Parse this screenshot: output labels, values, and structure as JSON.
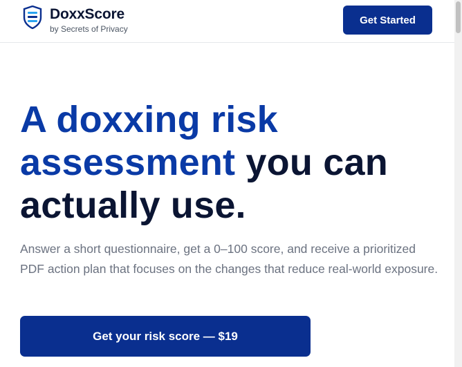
{
  "header": {
    "brand_name": "DoxxScore",
    "brand_sub": "by Secrets of Privacy",
    "cta_label": "Get Started"
  },
  "hero": {
    "title_accent_1": "A doxxing risk",
    "title_accent_2": "assessment",
    "title_plain_1": " you can",
    "title_plain_2": "actually use.",
    "description": "Answer a short questionnaire, get a 0–100 score, and receive a prioritized PDF action plan that focuses on the changes that reduce real-world exposure.",
    "cta_label": "Get your risk score — $19"
  },
  "icons": {
    "logo": "shield-logo-icon"
  },
  "colors": {
    "brand_primary": "#0a2f8f",
    "title_accent": "#0a3aa6",
    "title_dark": "#0b1533",
    "body_text": "#6b7280"
  }
}
